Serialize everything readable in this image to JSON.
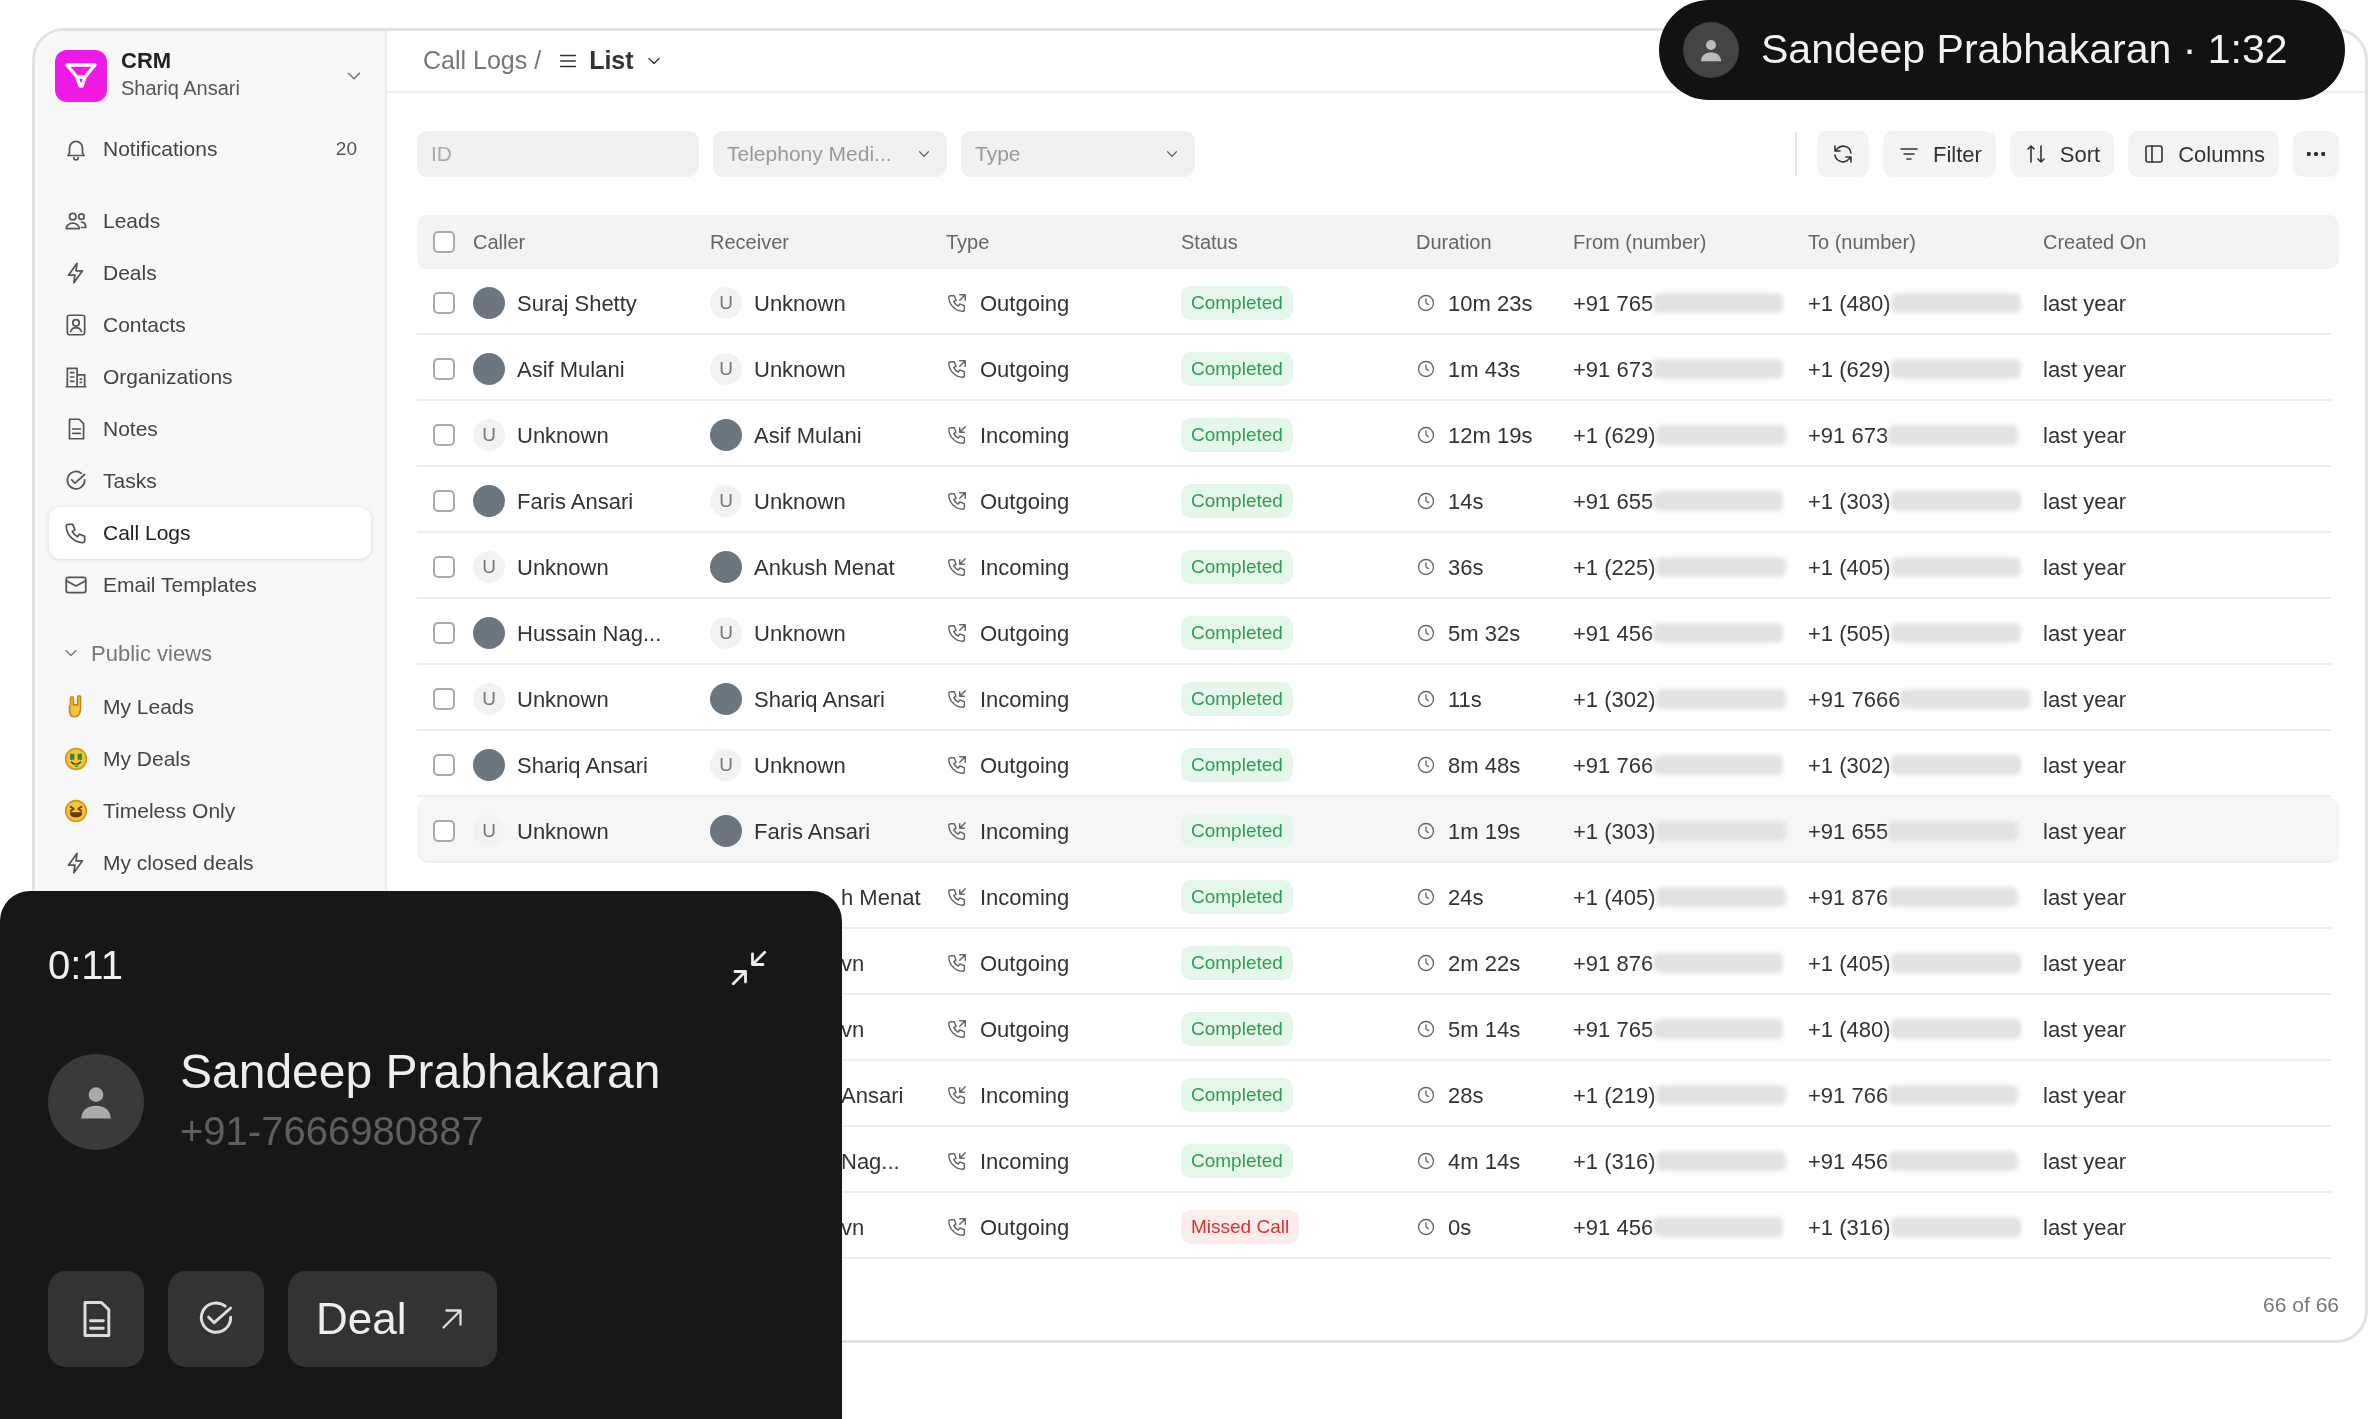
{
  "workspace": {
    "app_name": "CRM",
    "user": "Shariq Ansari"
  },
  "sidebar": {
    "items": [
      {
        "label": "Notifications",
        "count": "20",
        "selected": false
      },
      {
        "label": "Leads",
        "selected": false
      },
      {
        "label": "Deals",
        "selected": false
      },
      {
        "label": "Contacts",
        "selected": false
      },
      {
        "label": "Organizations",
        "selected": false
      },
      {
        "label": "Notes",
        "selected": false
      },
      {
        "label": "Tasks",
        "selected": false
      },
      {
        "label": "Call Logs",
        "selected": true
      },
      {
        "label": "Email Templates",
        "selected": false
      }
    ],
    "section": {
      "title": "Public views",
      "expanded": true,
      "items": [
        {
          "label": "My Leads",
          "selected": false
        },
        {
          "label": "My Deals",
          "selected": false
        },
        {
          "label": "Timeless Only",
          "selected": false
        },
        {
          "label": "My closed deals",
          "selected": false
        }
      ]
    }
  },
  "header": {
    "breadcrumb": "Call Logs /",
    "view": "List"
  },
  "filters": {
    "id_placeholder": "ID",
    "medium_placeholder": "Telephony Medi...",
    "type_placeholder": "Type"
  },
  "toolbar": [
    "Filter",
    "Sort",
    "Columns"
  ],
  "table": {
    "all_checked": false,
    "columns": [
      "Caller",
      "Receiver",
      "Type",
      "Status",
      "Duration",
      "From (number)",
      "To (number)",
      "Created On"
    ],
    "rows": [
      {
        "checked": false,
        "hovered": false,
        "caller": {
          "name": "Suraj Shetty",
          "kind": "photo"
        },
        "receiver": {
          "name": "Unknown",
          "kind": "initial",
          "initial": "U"
        },
        "type": {
          "label": "Outgoing",
          "kind": "outgoing"
        },
        "status": {
          "label": "Completed",
          "kind": "completed"
        },
        "duration": "10m 23s",
        "from": "+91 765",
        "to": "+1 (480)",
        "created": "last year"
      },
      {
        "checked": false,
        "hovered": false,
        "caller": {
          "name": "Asif Mulani",
          "kind": "photo"
        },
        "receiver": {
          "name": "Unknown",
          "kind": "initial",
          "initial": "U"
        },
        "type": {
          "label": "Outgoing",
          "kind": "outgoing"
        },
        "status": {
          "label": "Completed",
          "kind": "completed"
        },
        "duration": "1m 43s",
        "from": "+91 673",
        "to": "+1 (629)",
        "created": "last year"
      },
      {
        "checked": false,
        "hovered": false,
        "caller": {
          "name": "Unknown",
          "kind": "initial",
          "initial": "U"
        },
        "receiver": {
          "name": "Asif Mulani",
          "kind": "photo"
        },
        "type": {
          "label": "Incoming",
          "kind": "incoming"
        },
        "status": {
          "label": "Completed",
          "kind": "completed"
        },
        "duration": "12m 19s",
        "from": "+1 (629)",
        "to": "+91 673",
        "created": "last year"
      },
      {
        "checked": false,
        "hovered": false,
        "caller": {
          "name": "Faris Ansari",
          "kind": "photo"
        },
        "receiver": {
          "name": "Unknown",
          "kind": "initial",
          "initial": "U"
        },
        "type": {
          "label": "Outgoing",
          "kind": "outgoing"
        },
        "status": {
          "label": "Completed",
          "kind": "completed"
        },
        "duration": "14s",
        "from": "+91 655",
        "to": "+1 (303)",
        "created": "last year"
      },
      {
        "checked": false,
        "hovered": false,
        "caller": {
          "name": "Unknown",
          "kind": "initial",
          "initial": "U"
        },
        "receiver": {
          "name": "Ankush Menat",
          "kind": "photo"
        },
        "type": {
          "label": "Incoming",
          "kind": "incoming"
        },
        "status": {
          "label": "Completed",
          "kind": "completed"
        },
        "duration": "36s",
        "from": "+1 (225)",
        "to": "+1 (405)",
        "created": "last year"
      },
      {
        "checked": false,
        "hovered": false,
        "caller": {
          "name": "Hussain Nag...",
          "kind": "photo"
        },
        "receiver": {
          "name": "Unknown",
          "kind": "initial",
          "initial": "U"
        },
        "type": {
          "label": "Outgoing",
          "kind": "outgoing"
        },
        "status": {
          "label": "Completed",
          "kind": "completed"
        },
        "duration": "5m 32s",
        "from": "+91 456",
        "to": "+1 (505)",
        "created": "last year"
      },
      {
        "checked": false,
        "hovered": false,
        "caller": {
          "name": "Unknown",
          "kind": "initial",
          "initial": "U"
        },
        "receiver": {
          "name": "Shariq Ansari",
          "kind": "photo"
        },
        "type": {
          "label": "Incoming",
          "kind": "incoming"
        },
        "status": {
          "label": "Completed",
          "kind": "completed"
        },
        "duration": "11s",
        "from": "+1 (302)",
        "to": "+91 7666",
        "created": "last year"
      },
      {
        "checked": false,
        "hovered": false,
        "caller": {
          "name": "Shariq Ansari",
          "kind": "photo"
        },
        "receiver": {
          "name": "Unknown",
          "kind": "initial",
          "initial": "U"
        },
        "type": {
          "label": "Outgoing",
          "kind": "outgoing"
        },
        "status": {
          "label": "Completed",
          "kind": "completed"
        },
        "duration": "8m 48s",
        "from": "+91 766",
        "to": "+1 (302)",
        "created": "last year"
      },
      {
        "checked": false,
        "hovered": true,
        "caller": {
          "name": "Unknown",
          "kind": "initial",
          "initial": "U"
        },
        "receiver": {
          "name": "Faris Ansari",
          "kind": "photo"
        },
        "type": {
          "label": "Incoming",
          "kind": "incoming"
        },
        "status": {
          "label": "Completed",
          "kind": "completed"
        },
        "duration": "1m 19s",
        "from": "+1 (303)",
        "to": "+91 655",
        "created": "last year"
      },
      {
        "hovered": false,
        "receiver": {
          "name": "h Menat",
          "kind": "partial"
        },
        "type": {
          "label": "Incoming",
          "kind": "incoming"
        },
        "status": {
          "label": "Completed",
          "kind": "completed"
        },
        "duration": "24s",
        "from": "+1 (405)",
        "to": "+91 876",
        "created": "last year"
      },
      {
        "hovered": false,
        "receiver": {
          "name": "vn",
          "kind": "partial"
        },
        "type": {
          "label": "Outgoing",
          "kind": "outgoing"
        },
        "status": {
          "label": "Completed",
          "kind": "completed"
        },
        "duration": "2m 22s",
        "from": "+91 876",
        "to": "+1 (405)",
        "created": "last year"
      },
      {
        "hovered": false,
        "receiver": {
          "name": "vn",
          "kind": "partial"
        },
        "type": {
          "label": "Outgoing",
          "kind": "outgoing"
        },
        "status": {
          "label": "Completed",
          "kind": "completed"
        },
        "duration": "5m 14s",
        "from": "+91 765",
        "to": "+1 (480)",
        "created": "last year"
      },
      {
        "hovered": false,
        "receiver": {
          "name": "Ansari",
          "kind": "partial"
        },
        "type": {
          "label": "Incoming",
          "kind": "incoming"
        },
        "status": {
          "label": "Completed",
          "kind": "completed"
        },
        "duration": "28s",
        "from": "+1 (219)",
        "to": "+91 766",
        "created": "last year"
      },
      {
        "hovered": false,
        "receiver": {
          "name": "Nag...",
          "kind": "partial"
        },
        "type": {
          "label": "Incoming",
          "kind": "incoming"
        },
        "status": {
          "label": "Completed",
          "kind": "completed"
        },
        "duration": "4m 14s",
        "from": "+1 (316)",
        "to": "+91 456",
        "created": "last year"
      },
      {
        "hovered": false,
        "receiver": {
          "name": "vn",
          "kind": "partial"
        },
        "type": {
          "label": "Outgoing",
          "kind": "outgoing"
        },
        "status": {
          "label": "Missed Call",
          "kind": "missed"
        },
        "duration": "0s",
        "from": "+91 456",
        "to": "+1 (316)",
        "created": "last year"
      }
    ],
    "footer": "66 of 66"
  },
  "call_banner": {
    "text": "Sandeep Prabhakaran · 1:32"
  },
  "call_panel": {
    "timer": "0:11",
    "name": "Sandeep Prabhakaran",
    "phone": "+91-7666980887",
    "deal_button": "Deal"
  }
}
